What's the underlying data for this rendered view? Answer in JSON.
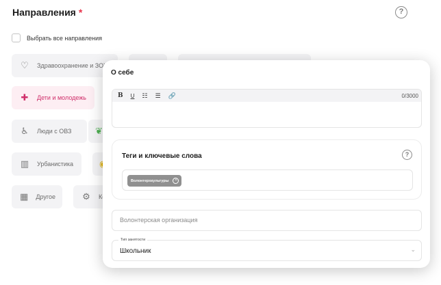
{
  "section": {
    "title": "Направления",
    "required_mark": "*",
    "help_icon": "question-circle-icon"
  },
  "select_all": {
    "label": "Выбрать все направления",
    "checked": false
  },
  "chips": [
    {
      "label": "Здравоохранение и ЗОЖ",
      "icon": "heart-pulse-icon",
      "active": false
    },
    {
      "label": "",
      "icon": "",
      "active": false
    },
    {
      "label": "",
      "icon": "",
      "active": false
    },
    {
      "label": "Дети и молодежь",
      "icon": "children-icon",
      "active": true
    },
    {
      "label": "Люди с ОВЗ",
      "icon": "wheelchair-icon",
      "active": false
    },
    {
      "label": "",
      "icon": "sprout-icon",
      "active": false
    },
    {
      "label": "Урбанистика",
      "icon": "buildings-icon",
      "active": false
    },
    {
      "label": "",
      "icon": "bulb-icon",
      "active": false
    },
    {
      "label": "Другое",
      "icon": "grid-icon",
      "active": false
    },
    {
      "label": "Ко",
      "icon": "gear-icon",
      "active": false
    }
  ],
  "modal": {
    "about_title": "О себе",
    "editor": {
      "toolbar": {
        "bold": "B",
        "underline": "U",
        "bullet_list": "☷",
        "numbered_list": "☰",
        "link": "🔗"
      },
      "counter": "0/3000"
    },
    "tags": {
      "title": "Теги и ключевые слова",
      "items": [
        {
          "label": "Волонтерхкультуры"
        }
      ]
    },
    "org_placeholder": "Волонтерская организация",
    "employment": {
      "legend": "Тип занятости",
      "value": "Школьник"
    }
  },
  "colors": {
    "accent": "#d0306b",
    "required": "#e8334a",
    "chip_bg": "#f3f3f5",
    "chip_active_bg": "#fdeef3",
    "tag_bg": "#909090"
  }
}
